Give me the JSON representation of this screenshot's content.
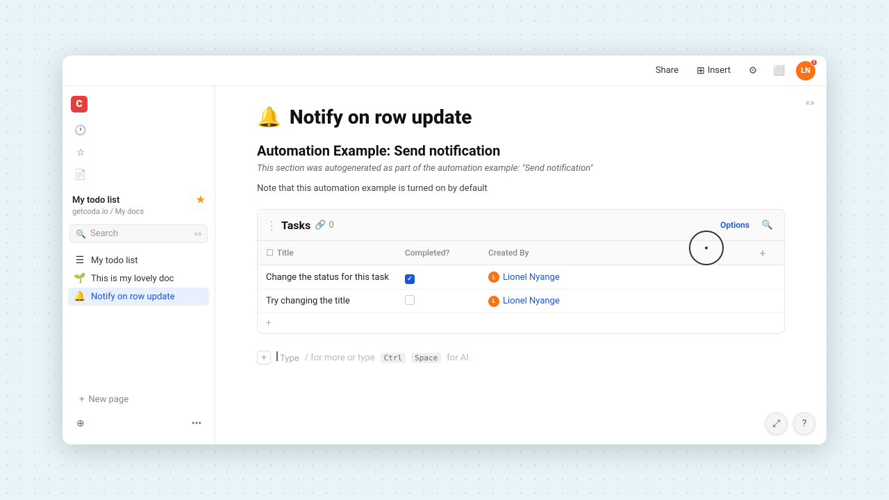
{
  "window": {
    "title": "My todo list"
  },
  "topbar": {
    "share_label": "Share",
    "insert_label": "Insert",
    "avatar_initials": "LN",
    "avatar_badge": "1"
  },
  "sidebar": {
    "logo": "C",
    "workspace": {
      "name": "My todo list",
      "path": "getcoda.io / My docs"
    },
    "search_placeholder": "Search",
    "nav_items": [
      {
        "id": "my-todo-list",
        "label": "My todo list",
        "icon": "☰",
        "active": false
      },
      {
        "id": "this-is-my-lovely-doc",
        "label": "This is my lovely doc",
        "icon": "🌱",
        "active": false
      },
      {
        "id": "notify-on-row-update",
        "label": "Notify on row update",
        "icon": "🔔",
        "active": true
      }
    ],
    "new_page_label": "New page"
  },
  "page": {
    "emoji": "🔔",
    "title": "Notify on row update",
    "section_heading": "Automation Example: Send notification",
    "section_subtitle": "This section was autogenerated as part of the automation example: \"Send notification\"",
    "section_note": "Note that this automation example is turned on by default",
    "tasks_table": {
      "title": "Tasks",
      "link_count": "0",
      "options_label": "Options",
      "columns": [
        "Title",
        "Completed?",
        "Created By"
      ],
      "rows": [
        {
          "title": "Change the status for this task",
          "completed": true,
          "created_by": "Lionel Nyange"
        },
        {
          "title": "Try changing the title",
          "completed": false,
          "created_by": "Lionel Nyange"
        }
      ]
    }
  },
  "type_bar": {
    "placeholder": "Type",
    "hint1": "/ for more or type",
    "shortcut_ctrl": "Ctrl",
    "shortcut_space": "Space",
    "hint2": "for AI"
  },
  "bottom_float": {
    "expand_icon": "⤢",
    "help_icon": "?"
  }
}
